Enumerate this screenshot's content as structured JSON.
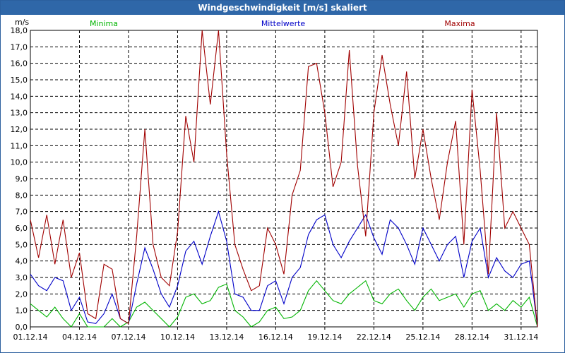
{
  "window": {
    "title": "Windgeschwindigkeit [m/s] skaliert"
  },
  "chart_data": {
    "type": "line",
    "title": "Windgeschwindigkeit [m/s] skaliert",
    "ylabel": "m/s",
    "ylim": [
      0,
      18
    ],
    "yticks": [
      "0,0",
      "1,0",
      "2,0",
      "3,0",
      "4,0",
      "5,0",
      "6,0",
      "7,0",
      "8,0",
      "9,0",
      "10,0",
      "11,0",
      "12,0",
      "13,0",
      "14,0",
      "15,0",
      "16,0",
      "17,0",
      "18,0"
    ],
    "xticks": [
      "01.12.14",
      "04.12.14",
      "07.12.14",
      "10.12.14",
      "13.12.14",
      "16.12.14",
      "19.12.14",
      "22.12.14",
      "25.12.14",
      "28.12.14",
      "31.12.14"
    ],
    "xlim_days": [
      1,
      32
    ],
    "grid": true,
    "legend_position": "top",
    "colors": {
      "minima": "#00b400",
      "mittelwerte": "#0000c8",
      "maxima": "#a00000"
    },
    "series": [
      {
        "name": "Minima",
        "color": "#00b400",
        "x": [
          1,
          1.5,
          2,
          2.5,
          3,
          3.5,
          4,
          4.5,
          5,
          5.5,
          6,
          6.5,
          7,
          7.5,
          8,
          8.5,
          9,
          9.5,
          10,
          10.5,
          11,
          11.5,
          12,
          12.5,
          13,
          13.5,
          14,
          14.5,
          15,
          15.5,
          16,
          16.5,
          17,
          17.5,
          18,
          18.5,
          19,
          19.5,
          20,
          20.5,
          21,
          21.5,
          22,
          22.5,
          23,
          23.5,
          24,
          24.5,
          25,
          25.5,
          26,
          26.5,
          27,
          27.5,
          28,
          28.5,
          29,
          29.5,
          30,
          30.5,
          31,
          31.5,
          32
        ],
        "values": [
          1.4,
          1.0,
          0.6,
          1.2,
          0.5,
          0,
          0.8,
          0,
          0,
          0,
          0.5,
          0,
          0.3,
          1.2,
          1.5,
          1.0,
          0.5,
          0,
          0.6,
          1.8,
          2.0,
          1.4,
          1.6,
          2.4,
          2.6,
          1.0,
          0.6,
          0,
          0.3,
          1.0,
          1.2,
          0.5,
          0.6,
          1.0,
          2.2,
          2.8,
          2.2,
          1.6,
          1.4,
          2.0,
          2.4,
          2.8,
          1.6,
          1.4,
          2.0,
          2.3,
          1.6,
          1.0,
          1.8,
          2.3,
          1.6,
          1.8,
          2.0,
          1.2,
          2.0,
          2.2,
          1.0,
          1.4,
          1.0,
          1.6,
          1.2,
          1.8,
          0
        ]
      },
      {
        "name": "Mittelwerte",
        "color": "#0000c8",
        "x": [
          1,
          1.5,
          2,
          2.5,
          3,
          3.5,
          4,
          4.5,
          5,
          5.5,
          6,
          6.5,
          7,
          7.5,
          8,
          8.5,
          9,
          9.5,
          10,
          10.5,
          11,
          11.5,
          12,
          12.5,
          13,
          13.5,
          14,
          14.5,
          15,
          15.5,
          16,
          16.5,
          17,
          17.5,
          18,
          18.5,
          19,
          19.5,
          20,
          20.5,
          21,
          21.5,
          22,
          22.5,
          23,
          23.5,
          24,
          24.5,
          25,
          25.5,
          26,
          26.5,
          27,
          27.5,
          28,
          28.5,
          29,
          29.5,
          30,
          30.5,
          31,
          31.5,
          32
        ],
        "values": [
          3.2,
          2.5,
          2.2,
          3.0,
          2.8,
          1.0,
          1.8,
          0.3,
          0.2,
          0.8,
          2.0,
          0.5,
          0.2,
          2.6,
          4.8,
          3.5,
          2.0,
          1.2,
          2.5,
          4.6,
          5.2,
          3.8,
          5.5,
          7.0,
          5.2,
          2.0,
          1.8,
          1.0,
          1.0,
          2.5,
          2.8,
          1.4,
          3.0,
          3.6,
          5.6,
          6.5,
          6.8,
          5.0,
          4.2,
          5.2,
          6.0,
          6.8,
          5.4,
          4.4,
          6.5,
          6.0,
          5.0,
          3.8,
          6.0,
          5.0,
          4.0,
          5.0,
          5.5,
          3.0,
          5.2,
          6.0,
          3.0,
          4.2,
          3.4,
          3.0,
          3.8,
          4.0,
          0
        ]
      },
      {
        "name": "Maxima",
        "color": "#a00000",
        "x": [
          1,
          1.5,
          2,
          2.5,
          3,
          3.5,
          4,
          4.5,
          5,
          5.5,
          6,
          6.5,
          7,
          7.5,
          8,
          8.5,
          9,
          9.5,
          10,
          10.5,
          11,
          11.5,
          12,
          12.5,
          13,
          13.5,
          14,
          14.5,
          15,
          15.5,
          16,
          16.5,
          17,
          17.5,
          18,
          18.5,
          19,
          19.5,
          20,
          20.5,
          21,
          21.5,
          22,
          22.5,
          23,
          23.5,
          24,
          24.5,
          25,
          25.5,
          26,
          26.5,
          27,
          27.5,
          28,
          28.5,
          29,
          29.5,
          30,
          30.5,
          31,
          31.5,
          32
        ],
        "values": [
          6.5,
          4.2,
          6.8,
          3.8,
          6.5,
          3.0,
          4.5,
          0.8,
          0.5,
          3.8,
          3.5,
          0.5,
          0.2,
          5.5,
          12.0,
          5.0,
          3.0,
          2.5,
          5.8,
          12.8,
          10.0,
          18.0,
          13.5,
          18.0,
          10.5,
          5.0,
          3.5,
          2.2,
          2.5,
          6.0,
          5.0,
          3.2,
          8.0,
          9.5,
          15.8,
          16.0,
          13.0,
          8.5,
          10.0,
          16.8,
          9.8,
          5.5,
          13.0,
          16.5,
          13.5,
          11.0,
          15.5,
          9.0,
          12.0,
          9.0,
          6.5,
          10.0,
          12.5,
          5.0,
          14.4,
          9.5,
          3.2,
          13.0,
          6.0,
          7.0,
          6.0,
          5.0,
          0
        ]
      }
    ]
  }
}
